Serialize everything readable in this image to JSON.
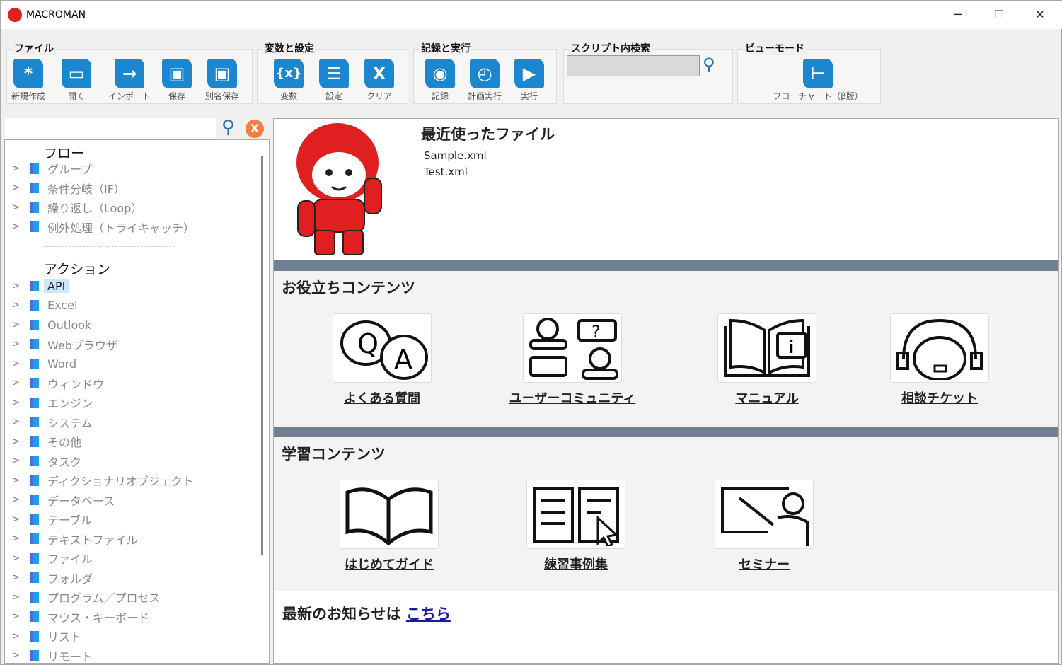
{
  "window": {
    "title": "MACROMAN",
    "minimize": "─",
    "maximize": "☐",
    "close": "✕"
  },
  "toolbar": {
    "groups": [
      {
        "title": "ファイル",
        "buttons": [
          {
            "label": "新規作成",
            "icon": "asterisk-icon"
          },
          {
            "label": "開く",
            "icon": "folder-icon"
          },
          {
            "label": "インポート",
            "icon": "arrow-right-icon"
          },
          {
            "label": "保存",
            "icon": "save-icon"
          },
          {
            "label": "別名保存",
            "icon": "save-as-icon"
          }
        ]
      },
      {
        "title": "変数と設定",
        "buttons": [
          {
            "label": "変数",
            "icon": "variable-icon"
          },
          {
            "label": "設定",
            "icon": "menu-icon"
          },
          {
            "label": "クリア",
            "icon": "clear-icon"
          }
        ]
      },
      {
        "title": "記録と実行",
        "buttons": [
          {
            "label": "記録",
            "icon": "record-icon"
          },
          {
            "label": "計画実行",
            "icon": "schedule-icon"
          },
          {
            "label": "実行",
            "icon": "play-icon"
          }
        ]
      },
      {
        "title": "スクリプト内検索"
      },
      {
        "title": "ビューモード",
        "buttons": [
          {
            "label": "フローチャート（β版）",
            "icon": "flowchart-icon"
          }
        ]
      }
    ],
    "script_search_value": ""
  },
  "sidebar": {
    "search_value": "",
    "flow_header": "フロー",
    "flow_items": [
      "グループ",
      "条件分岐（IF）",
      "繰り返し（Loop）",
      "例外処理（トライキャッチ）"
    ],
    "action_header": "アクション",
    "action_items": [
      "API",
      "Excel",
      "Outlook",
      "Webブラウザ",
      "Word",
      "ウィンドウ",
      "エンジン",
      "システム",
      "その他",
      "タスク",
      "ディクショナリオブジェクト",
      "データベース",
      "テーブル",
      "テキストファイル",
      "ファイル",
      "フォルダ",
      "プログラム／プロセス",
      "マウス・キーボード",
      "リスト",
      "リモート"
    ],
    "selected": "API"
  },
  "main": {
    "recent_title": "最近使ったファイル",
    "recent_files": [
      "Sample.xml",
      "Test.xml"
    ],
    "useful_title": "お役立ちコンテンツ",
    "useful": [
      "よくある質問",
      "ユーザーコミュニティ",
      "マニュアル",
      "相談チケット"
    ],
    "learning_title": "学習コンテンツ",
    "learning": [
      "はじめてガイド",
      "練習事例集",
      "セミナー"
    ],
    "news_text": "最新のお知らせは",
    "news_link": "こちら"
  },
  "colors": {
    "accent": "#1a87d0",
    "band": "#708090",
    "mascot": "#e02020",
    "clear_button": "#f08040"
  }
}
